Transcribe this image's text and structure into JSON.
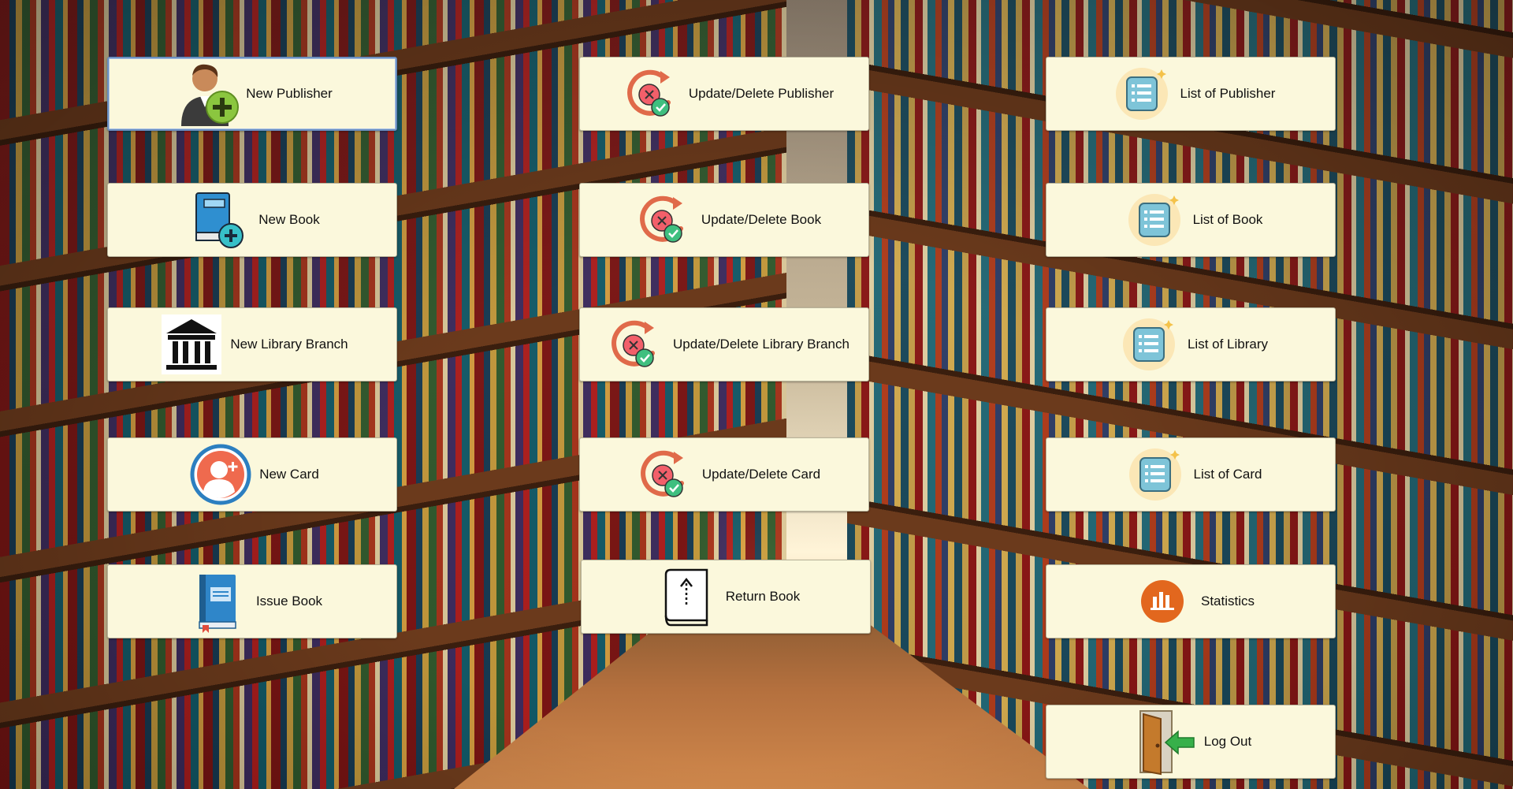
{
  "buttons": {
    "new_publisher": "New Publisher",
    "update_delete_publisher": "Update/Delete Publisher",
    "list_of_publisher": "List of Publisher",
    "new_book": "New Book",
    "update_delete_book": "Update/Delete Book",
    "list_of_book": "List of Book",
    "new_library_branch": "New Library Branch",
    "update_delete_library_branch": "Update/Delete Library Branch",
    "list_of_library": "List of Library",
    "new_card": "New Card",
    "update_delete_card": "Update/Delete Card",
    "list_of_card": "List of Card",
    "issue_book": "Issue Book",
    "return_book": "Return Book",
    "statistics": "Statistics",
    "log_out": "Log Out"
  },
  "icons": {
    "new_publisher": "person-add-icon",
    "update_delete": "refresh-delete-check-icon",
    "list": "list-icon",
    "new_book": "book-add-icon",
    "new_library_branch": "bank-building-icon",
    "new_card": "user-card-icon",
    "issue_book": "blue-book-icon",
    "return_book": "book-upload-icon",
    "statistics": "bar-chart-icon",
    "log_out": "door-exit-icon"
  },
  "colors": {
    "button_bg": "#fbf8dc",
    "focus_border": "#6a8ec0"
  }
}
